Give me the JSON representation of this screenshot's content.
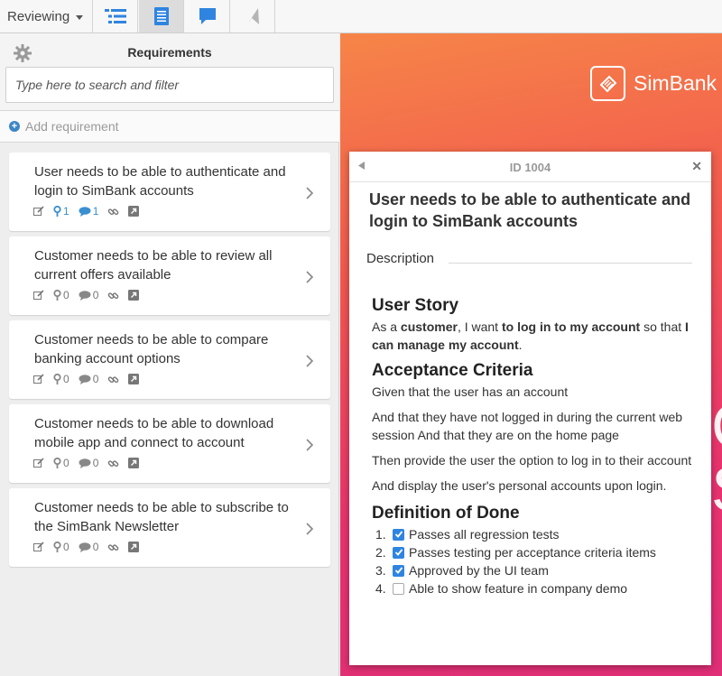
{
  "toolbar": {
    "mode_label": "Reviewing",
    "buttons": [
      {
        "icon": "list-tree-icon",
        "active": false
      },
      {
        "icon": "document-icon",
        "active": true
      },
      {
        "icon": "comment-icon",
        "active": false
      },
      {
        "icon": "cursor-arrow-icon",
        "active": false
      }
    ]
  },
  "sidebar": {
    "title": "Requirements",
    "search_placeholder": "Type here to search and filter",
    "add_label": "Add requirement",
    "items": [
      {
        "title": "User needs to be able to authenticate and login to SimBank accounts",
        "pins": "1",
        "comments": "1"
      },
      {
        "title": "Customer needs to be able to review all current offers available",
        "pins": "0",
        "comments": "0"
      },
      {
        "title": "Customer needs to be able to compare banking account options",
        "pins": "0",
        "comments": "0"
      },
      {
        "title": "Customer needs to be able to download mobile app and connect to account",
        "pins": "0",
        "comments": "0"
      },
      {
        "title": "Customer needs to be able to subscribe to the SimBank Newsletter",
        "pins": "0",
        "comments": "0"
      }
    ]
  },
  "background": {
    "brand": "SimBank"
  },
  "detail": {
    "id_label": "ID 1004",
    "title": "User needs to be able to authenticate and login to SimBank accounts",
    "description_label": "Description",
    "user_story": {
      "heading": "User Story",
      "t1": "As a ",
      "b1": "customer",
      "t2": ", I want ",
      "b2": "to log in to my account",
      "t3": " so that ",
      "b3": "I can manage my account",
      "t4": "."
    },
    "acceptance": {
      "heading": "Acceptance Criteria",
      "p1": "Given that the user has an account",
      "p2": "And that they have not logged in during the current web session And that they are on the home page",
      "p3": "Then provide the user the option to log in to their account",
      "p4": "And display the user's personal accounts upon login."
    },
    "dod": {
      "heading": "Definition of Done",
      "items": [
        {
          "num": "1.",
          "label": "Passes all regression tests",
          "checked": true
        },
        {
          "num": "2.",
          "label": "Passes testing per acceptance criteria items",
          "checked": true
        },
        {
          "num": "3.",
          "label": "Approved by the UI team",
          "checked": true
        },
        {
          "num": "4.",
          "label": "Able to show feature in company demo",
          "checked": false
        }
      ]
    }
  },
  "colors": {
    "accent": "#2f84e0",
    "bg_top": "#f68548",
    "bg_bottom": "#e02f77"
  }
}
